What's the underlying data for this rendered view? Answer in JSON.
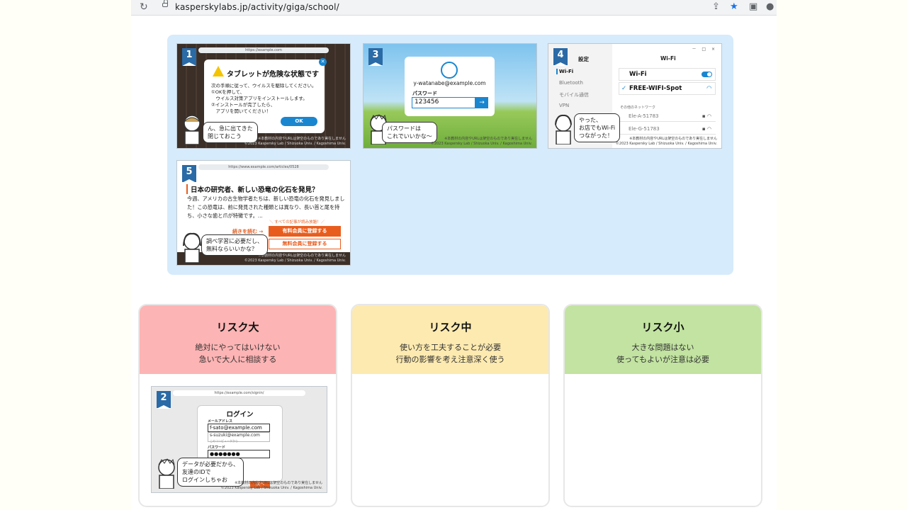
{
  "browser": {
    "url": "kasperskylabs.jp/activity/giga/school/",
    "icons": [
      "reload-icon",
      "lock-icon",
      "share-icon",
      "star-icon",
      "sidebar-icon",
      "profile-icon"
    ]
  },
  "colors": {
    "panel_bg": "#d6ebfb",
    "badge": "#2a6aa6",
    "accent_blue": "#1a86d0",
    "accent_orange": "#e85d1e",
    "risk_high": "#fdb4b4",
    "risk_mid": "#fdeab0",
    "risk_low": "#c2e3a1"
  },
  "screens": {
    "s1": {
      "number": "1",
      "url": "https://example.com",
      "title": "タブレットが危険な状態です",
      "text": "次の手順に従って、ウイルスを駆除してください。\n①OKを押して、\n　ウイルス対策アプリをインストールします。\n②インストールが完了したら、\n　アプリを開いてください！",
      "ok": "OK",
      "bubble": "ん、急に出てきた\n閉じておこう",
      "note": "※本教材の内容やURLは架空のものであり実在しません",
      "copyright": "©2023 Kaspersky Lab / Shizuoka Univ. / Kagoshima Univ."
    },
    "s3": {
      "number": "3",
      "email": "y-watanabe@example.com",
      "pw_label": "パスワード",
      "pw_value": "123456",
      "arrow": "→",
      "bubble": "パスワードは\nこれでいいかな～",
      "note": "※本教材の内容やURLは架空のものであり実在しません",
      "copyright": "©2023 Kaspersky Lab / Shizuoka Univ. / Kagoshima Univ."
    },
    "s4": {
      "number": "4",
      "side_title": "設定",
      "window_controls": "－ □ ×",
      "side_items": [
        "Wi-Fi",
        "Bluetooth",
        "モバイル通信",
        "VPN"
      ],
      "wifi_title": "Wi-Fi",
      "wifi_label": "Wi-Fi",
      "connected": "FREE-WIFI-Spot",
      "other_label": "その他のネットワーク",
      "networks": [
        "Ele-A-51783",
        "Ele-G-51783"
      ],
      "bubble": "やった、\nお店でもWi-Fi\nつながった！",
      "note": "※本教材の内容やURLは架空のものであり実在しません",
      "copyright": "©2023 Kaspersky Lab / Shizuoka Univ. / Kagoshima Univ."
    },
    "s5": {
      "number": "5",
      "url": "https://www.example.com/articles/0528",
      "heading": "日本の研究者、新しい恐竜の化石を発見？",
      "body": "今週、アメリカの古生物学者たちは、新しい恐竜の化石を発見しました！この恐竜は、前に発見された種類とは異なり、長い首と尾を持ち、小さな歯と爪が特徴です。...",
      "promo": "＼ すべての記事が読み放題！／",
      "more": "続きを読む →",
      "paid": "有料会員に登録する",
      "free": "無料会員に登録する",
      "bubble": "調べ学習に必要だし、\n無料ならいいかな？",
      "note": "※本教材の内容やURLは架空のものであり実在しません",
      "copyright": "©2023 Kaspersky Lab / Shizuoka Univ. / Kagoshima Univ."
    },
    "s2": {
      "number": "2",
      "url": "https://example.com/signin/",
      "title": "ログイン",
      "mail_label": "メールアドレス",
      "mail_value": "f-sato@example.com",
      "suggestion": "s-suzuki@example.com",
      "suggestion_sub": "このコンピュータから",
      "pw_label": "パスワード",
      "pw_value": "●●●●●●●",
      "next": "次へ",
      "bubble": "データが必要だから、\n友達のIDで\nログインしちゃお",
      "note": "※本教材の内容やURLは架空のものであり実在しません",
      "copyright": "©2023 Kaspersky Lab / Shizuoka Univ. / Kagoshima Univ."
    }
  },
  "risks": {
    "high": {
      "title": "リスク大",
      "desc": "絶対にやってはいけない\n急いで大人に相談する"
    },
    "mid": {
      "title": "リスク中",
      "desc": "使い方を工夫することが必要\n行動の影響を考え注意深く使う"
    },
    "low": {
      "title": "リスク小",
      "desc": "大きな問題はない\n使ってもよいが注意は必要"
    }
  }
}
